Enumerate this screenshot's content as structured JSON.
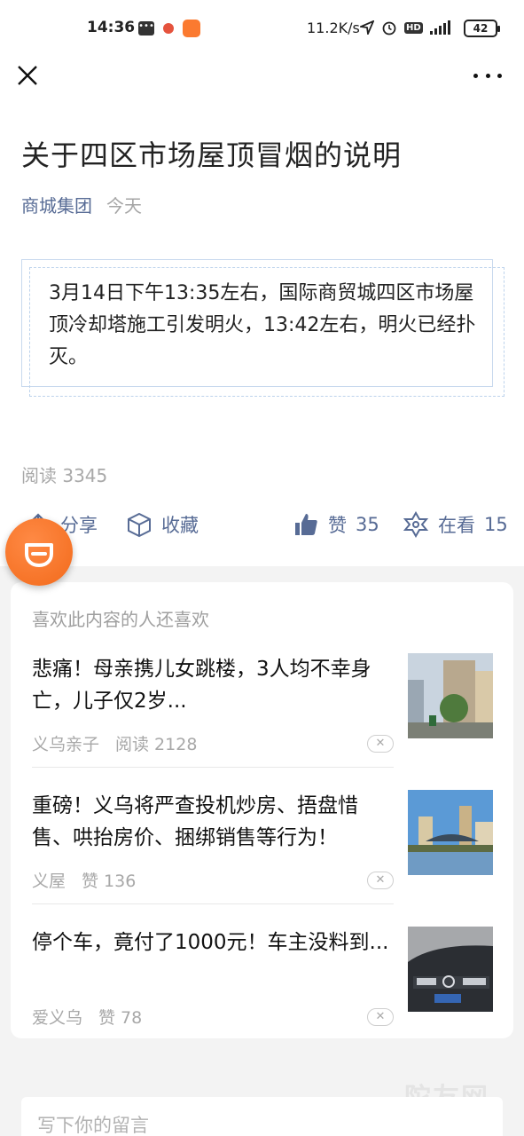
{
  "status_bar": {
    "time": "14:36",
    "net_speed": "11.2K/s",
    "battery": "42",
    "network": "5G"
  },
  "article": {
    "title": "关于四区市场屋顶冒烟的说明",
    "account": "商城集团",
    "date": "今天",
    "body": "3月14日下午13:35左右，国际商贸城四区市场屋顶冷却塔施工引发明火，13:42左右，明火已经扑灭。",
    "read_label": "阅读 3345"
  },
  "actions": {
    "share": "分享",
    "favorite": "收藏",
    "like": "赞",
    "like_count": "35",
    "looking": "在看",
    "looking_count": "15"
  },
  "recommend": {
    "title": "喜欢此内容的人还喜欢",
    "items": [
      {
        "headline": "悲痛！母亲携儿女跳楼，3人均不幸身亡，儿子仅2岁...",
        "source": "义乌亲子",
        "stat": "阅读 2128"
      },
      {
        "headline": "重磅！义乌将严查投机炒房、捂盘惜售、哄抬房价、捆绑销售等行为！",
        "source": "义屋",
        "stat": "赞 136"
      },
      {
        "headline": "停个车，竟付了1000元！车主没料到...",
        "source": "爱义乌",
        "stat": "赞 78"
      }
    ]
  },
  "comment": {
    "placeholder": "写下你的留言"
  },
  "watermark": "陀友网"
}
